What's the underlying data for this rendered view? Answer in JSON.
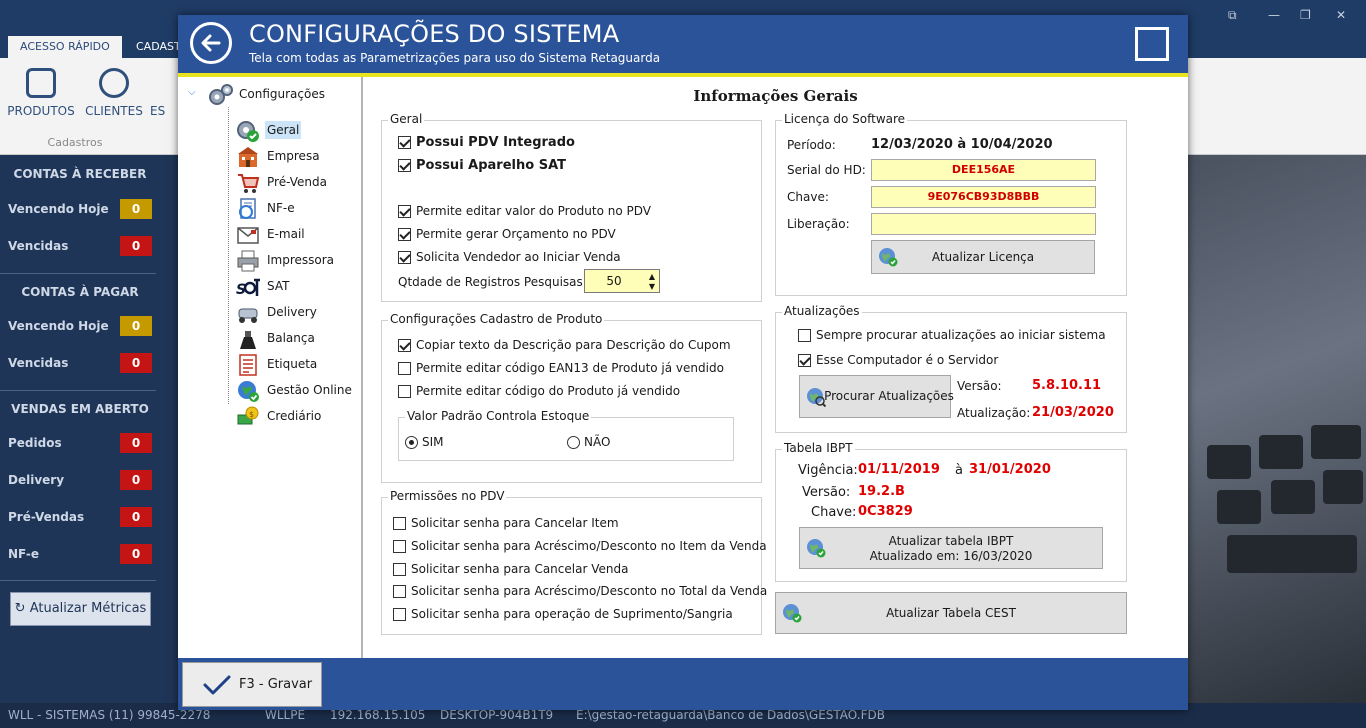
{
  "background_app": {
    "tabs": [
      "ACESSO RÁPIDO",
      "CADAST"
    ],
    "ribbon": {
      "buttons": [
        "PRODUTOS",
        "CLIENTES",
        "ES"
      ],
      "group_label": "Cadastros"
    },
    "sidebar": {
      "contas_receber": {
        "title": "CONTAS À RECEBER",
        "rows": [
          {
            "label": "Vencendo Hoje",
            "value": "0"
          },
          {
            "label": "Vencidas",
            "value": "0"
          }
        ]
      },
      "contas_pagar": {
        "title": "CONTAS À PAGAR",
        "rows": [
          {
            "label": "Vencendo Hoje",
            "value": "0"
          },
          {
            "label": "Vencidas",
            "value": "0"
          }
        ]
      },
      "vendas_aberto": {
        "title": "VENDAS EM ABERTO",
        "rows": [
          {
            "label": "Pedidos",
            "value": "0"
          },
          {
            "label": "Delivery",
            "value": "0"
          },
          {
            "label": "Pré-Vendas",
            "value": "0"
          },
          {
            "label": "NF-e",
            "value": "0"
          }
        ]
      },
      "update_button": "Atualizar Métricas"
    },
    "status_bar": [
      "WLL - SISTEMAS (11) 99845-2278",
      "WLLPE",
      "192.168.15.105",
      "DESKTOP-904B1T9",
      "E:\\gestao-retaguarda\\Banco de Dados\\GESTAO.FDB"
    ],
    "colors": {
      "warning_badge": "#c59a00",
      "danger_badge": "#c41414"
    }
  },
  "modal": {
    "title": "CONFIGURAÇÕES DO SISTEMA",
    "subtitle": "Tela com todas as Parametrizações para uso do Sistema Retaguarda",
    "colors": {
      "header": "#2b539a",
      "stripe": "#e9e41f",
      "highlight_field": "#fffeb8",
      "value_red": "#e00000"
    },
    "tree": {
      "root": "Configurações",
      "items": [
        {
          "label": "Geral",
          "icon": "gear-check-icon",
          "selected": true
        },
        {
          "label": "Empresa",
          "icon": "building-icon"
        },
        {
          "label": "Pré-Venda",
          "icon": "shopping-cart-icon"
        },
        {
          "label": "NF-e",
          "icon": "nfe-document-icon"
        },
        {
          "label": "E-mail",
          "icon": "envelope-icon"
        },
        {
          "label": "Impressora",
          "icon": "printer-icon"
        },
        {
          "label": "SAT",
          "icon": "sat-logo-icon"
        },
        {
          "label": "Delivery",
          "icon": "scooter-icon"
        },
        {
          "label": "Balança",
          "icon": "scale-icon"
        },
        {
          "label": "Etiqueta",
          "icon": "label-sheet-icon"
        },
        {
          "label": "Gestão Online",
          "icon": "globe-icon"
        },
        {
          "label": "Crediário",
          "icon": "money-icon"
        }
      ]
    },
    "content": {
      "title": "Informações Gerais",
      "geral": {
        "title": "Geral",
        "pdv_integrado": "Possui PDV Integrado",
        "aparelho_sat": "Possui Aparelho SAT",
        "editar_valor": "Permite editar valor do Produto no PDV",
        "gerar_orcamento": "Permite gerar Orçamento no PDV",
        "solicita_vendedor": "Solicita Vendedor ao Iniciar Venda",
        "qtd_registros_label": "Qtdade de Registros Pesquisas:",
        "qtd_registros_value": "50"
      },
      "cadastro_produto": {
        "title": "Configurações Cadastro de Produto",
        "copiar_descricao": "Copiar texto da Descrição para Descrição do Cupom",
        "editar_ean": "Permite editar código EAN13 de Produto já vendido",
        "editar_codigo": "Permite editar código do Produto já vendido",
        "estoque_title": "Valor Padrão Controla Estoque",
        "sim": "SIM",
        "nao": "NÃO"
      },
      "permissoes_pdv": {
        "title": "Permissões no PDV",
        "items": [
          "Solicitar senha para Cancelar Item",
          "Solicitar senha para Acréscimo/Desconto no Item da Venda",
          "Solicitar senha para Cancelar Venda",
          "Solicitar senha para Acréscimo/Desconto no Total da Venda",
          "Solicitar senha para operação de Suprimento/Sangria"
        ]
      },
      "licenca": {
        "title": "Licença do Software",
        "periodo_label": "Período:",
        "periodo_value": "12/03/2020 à 10/04/2020",
        "serial_label": "Serial do HD:",
        "serial_value": "DEE156AE",
        "chave_label": "Chave:",
        "chave_value": "9E076CB93D8BBB",
        "liberacao_label": "Liberação:",
        "liberacao_value": "",
        "button": "Atualizar Licença"
      },
      "atualizacoes": {
        "title": "Atualizações",
        "sempre_procurar": "Sempre procurar atualizações ao iniciar sistema",
        "computador_servidor": "Esse Computador é o Servidor",
        "button": "Procurar Atualizações",
        "versao_label": "Versão:",
        "versao_value": "5.8.10.11",
        "atualizacao_label": "Atualização:",
        "atualizacao_value": "21/03/2020"
      },
      "ibpt": {
        "title": "Tabela IBPT",
        "vigencia_label": "Vigência:",
        "vigencia_start": "01/11/2019",
        "vigencia_sep": "à",
        "vigencia_end": "31/01/2020",
        "versao_label": "Versão:",
        "versao_value": "19.2.B",
        "chave_label": "Chave:",
        "chave_value": "0C3829",
        "button_line1": "Atualizar tabela IBPT",
        "button_line2": "Atualizado em: 16/03/2020"
      },
      "cest_button": "Atualizar Tabela CEST"
    },
    "footer": {
      "save_button": "F3 - Gravar"
    }
  }
}
